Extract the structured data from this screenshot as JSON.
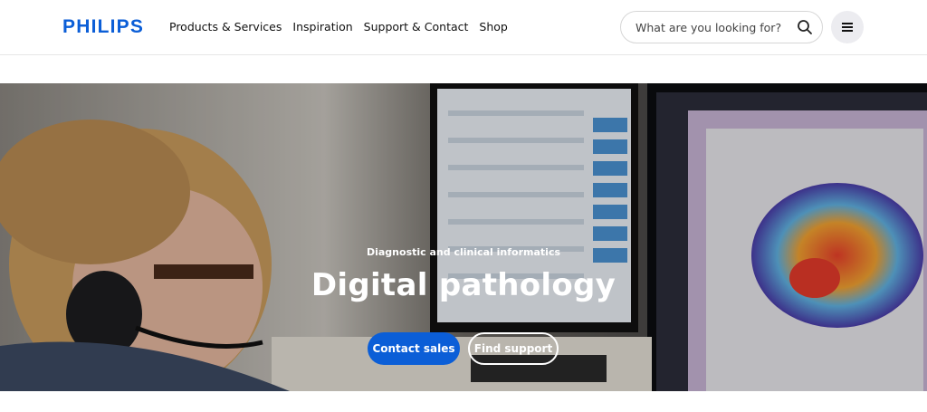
{
  "brand": {
    "logo_text": "PHILIPS",
    "color": "#0b5ed7"
  },
  "nav": {
    "items": [
      {
        "label": "Products & Services"
      },
      {
        "label": "Inspiration"
      },
      {
        "label": "Support & Contact"
      },
      {
        "label": "Shop"
      }
    ]
  },
  "search": {
    "placeholder": "What are you looking for?",
    "icon": "search-icon"
  },
  "menu": {
    "icon": "hamburger-menu-icon"
  },
  "hero": {
    "eyebrow": "Diagnostic and clinical informatics",
    "title": "Digital pathology",
    "image": "man-with-headset-viewing-pathology-scans",
    "primary_cta": "Contact sales",
    "secondary_cta": "Find support",
    "primary_color": "#0b5ed7"
  }
}
